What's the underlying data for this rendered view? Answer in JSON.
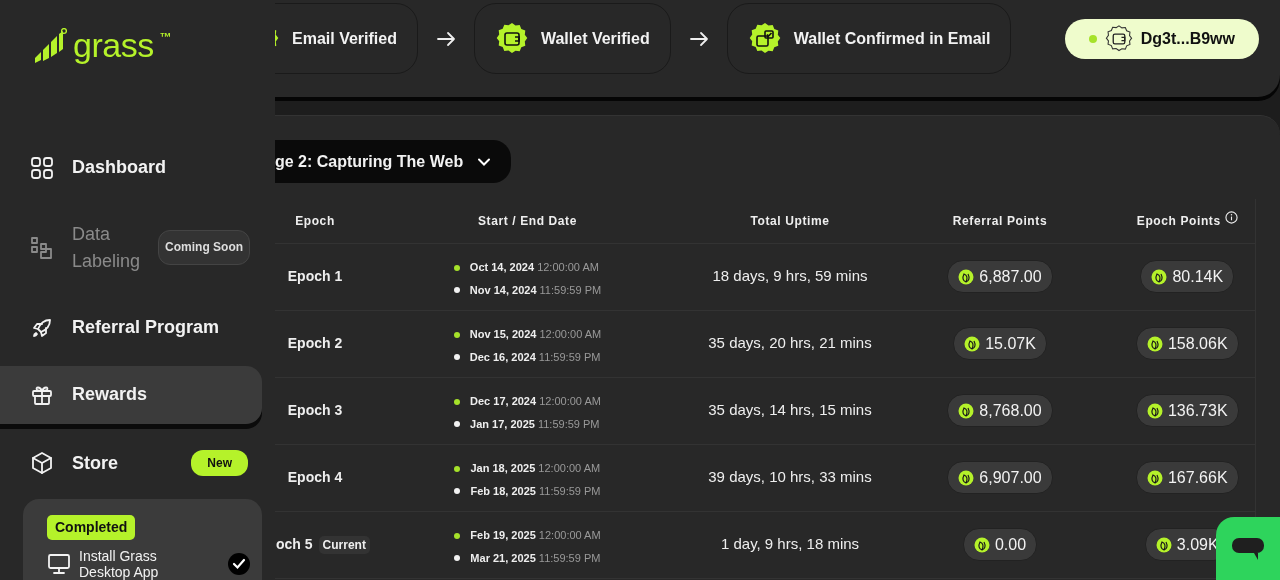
{
  "brand": {
    "name": "grass",
    "mark": "™"
  },
  "sidebar": {
    "items": [
      {
        "label": "Dashboard",
        "selected": false,
        "disabled": false
      },
      {
        "label": "Data Labeling",
        "selected": false,
        "disabled": true,
        "badge": {
          "text": "Coming Soon",
          "kind": "muted"
        }
      },
      {
        "label": "Referral Program",
        "selected": false,
        "disabled": false
      },
      {
        "label": "Rewards",
        "selected": true,
        "disabled": false
      },
      {
        "label": "Store",
        "selected": false,
        "disabled": false,
        "badge": {
          "text": "New",
          "kind": "accent"
        }
      }
    ],
    "task_card": {
      "status": "Completed",
      "items": [
        {
          "label": "Install Grass Desktop App",
          "checked": true
        }
      ]
    }
  },
  "steps": [
    {
      "label": "Email Verified"
    },
    {
      "label": "Wallet Verified"
    },
    {
      "label": "Wallet Confirmed in Email"
    }
  ],
  "wallet": {
    "address": "Dg3t...B9ww"
  },
  "stage_dropdown": {
    "label": "ge 2: Capturing The Web"
  },
  "table": {
    "columns": [
      "Epoch",
      "Start / End Date",
      "Total Uptime",
      "Referral Points",
      "Epoch Points"
    ],
    "rows": [
      {
        "epoch": "Epoch 1",
        "start_date": "Oct 14, 2024",
        "start_time": "12:00:00 AM",
        "end_date": "Nov 14, 2024",
        "end_time": "11:59:59 PM",
        "uptime": "18 days, 9 hrs, 59 mins",
        "referral_points": "6,887.00",
        "epoch_points": "80.14K"
      },
      {
        "epoch": "Epoch 2",
        "start_date": "Nov 15, 2024",
        "start_time": "12:00:00 AM",
        "end_date": "Dec 16, 2024",
        "end_time": "11:59:59 PM",
        "uptime": "35 days, 20 hrs, 21 mins",
        "referral_points": "15.07K",
        "epoch_points": "158.06K"
      },
      {
        "epoch": "Epoch 3",
        "start_date": "Dec 17, 2024",
        "start_time": "12:00:00 AM",
        "end_date": "Jan 17, 2025",
        "end_time": "11:59:59 PM",
        "uptime": "35 days, 14 hrs, 15 mins",
        "referral_points": "8,768.00",
        "epoch_points": "136.73K"
      },
      {
        "epoch": "Epoch 4",
        "start_date": "Jan 18, 2025",
        "start_time": "12:00:00 AM",
        "end_date": "Feb 18, 2025",
        "end_time": "11:59:59 PM",
        "uptime": "39 days, 10 hrs, 33 mins",
        "referral_points": "6,907.00",
        "epoch_points": "167.66K"
      },
      {
        "epoch": "och 5",
        "tag": "Current",
        "start_date": "Feb 19, 2025",
        "start_time": "12:00:00 AM",
        "end_date": "Mar 21, 2025",
        "end_time": "11:59:59 PM",
        "uptime": "1 day, 9 hrs, 18 mins",
        "referral_points": "0.00",
        "epoch_points": "3.09K"
      }
    ]
  }
}
